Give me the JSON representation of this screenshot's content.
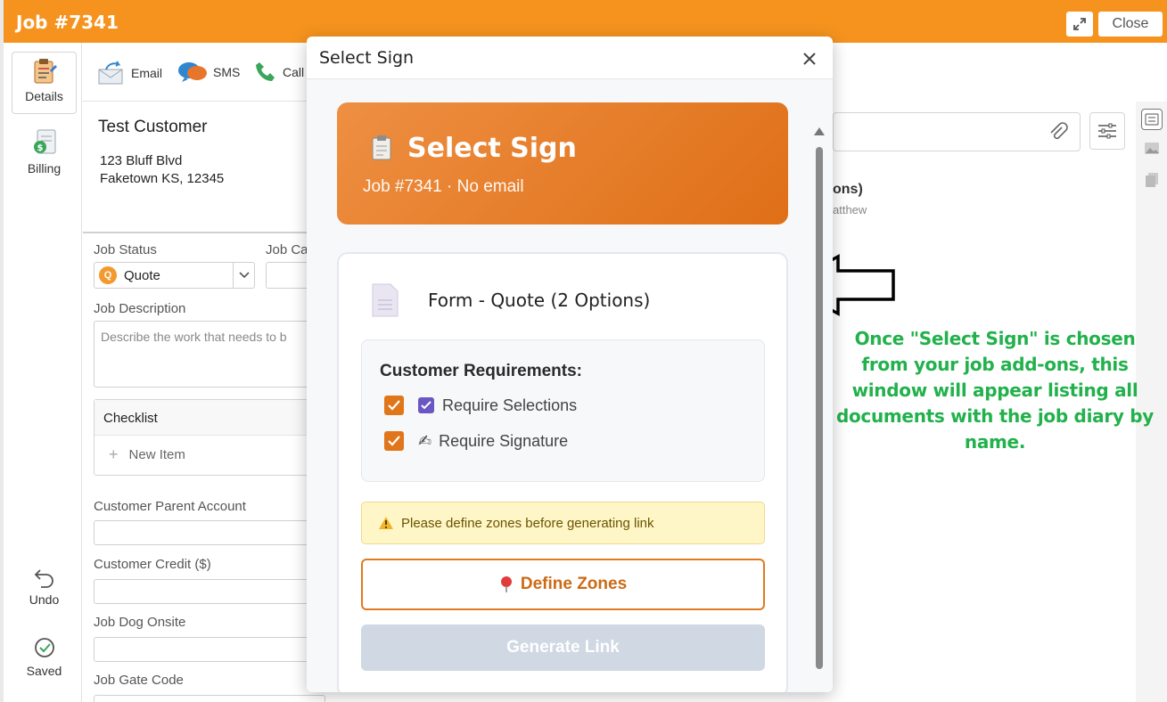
{
  "header": {
    "title": "Job #7341",
    "close_label": "Close"
  },
  "sidebar": {
    "items": [
      {
        "label": "Details"
      },
      {
        "label": "Billing"
      }
    ],
    "undo_label": "Undo",
    "saved_label": "Saved"
  },
  "actions": [
    {
      "label": "Email"
    },
    {
      "label": "SMS"
    },
    {
      "label": "Call"
    }
  ],
  "customer": {
    "name": "Test Customer",
    "address_line1": "123 Bluff Blvd",
    "address_line2": "Faketown KS, 12345"
  },
  "form": {
    "job_status_label": "Job Status",
    "job_status_value": "Quote",
    "job_status_badge": "Q",
    "job_category_label": "Job Cat",
    "job_description_label": "Job Description",
    "job_description_placeholder": "Describe the work that needs to b",
    "checklist_label": "Checklist",
    "new_item_label": "New Item",
    "parent_account_label": "Customer Parent Account",
    "credit_label": "Customer Credit ($)",
    "dog_label": "Job Dog Onsite",
    "gate_label": "Job Gate Code"
  },
  "diary": {
    "title_fragment": "ons)",
    "sub_fragment": "atthew"
  },
  "annotation": {
    "text": "Once \"Select Sign\" is chosen from your job add-ons, this window will appear listing all documents with the job diary by name."
  },
  "modal": {
    "title": "Select Sign",
    "hero_title": "Select Sign",
    "hero_subtitle": "Job #7341 · No email",
    "document_title": "Form - Quote (2 Options)",
    "requirements_title": "Customer Requirements:",
    "requirements": [
      {
        "label": "Require Selections",
        "checked": true,
        "icon": "checkbox-emoji"
      },
      {
        "label": "Require Signature",
        "checked": true,
        "icon": "writing-hand-emoji"
      }
    ],
    "warning_text": "Please define zones before generating link",
    "define_zones_label": "Define Zones",
    "generate_link_label": "Generate Link"
  },
  "colors": {
    "brand_orange": "#f5931e",
    "accent_orange": "#e07619",
    "annotation_green": "#22b14c",
    "disabled_button": "#cfd8e3"
  }
}
